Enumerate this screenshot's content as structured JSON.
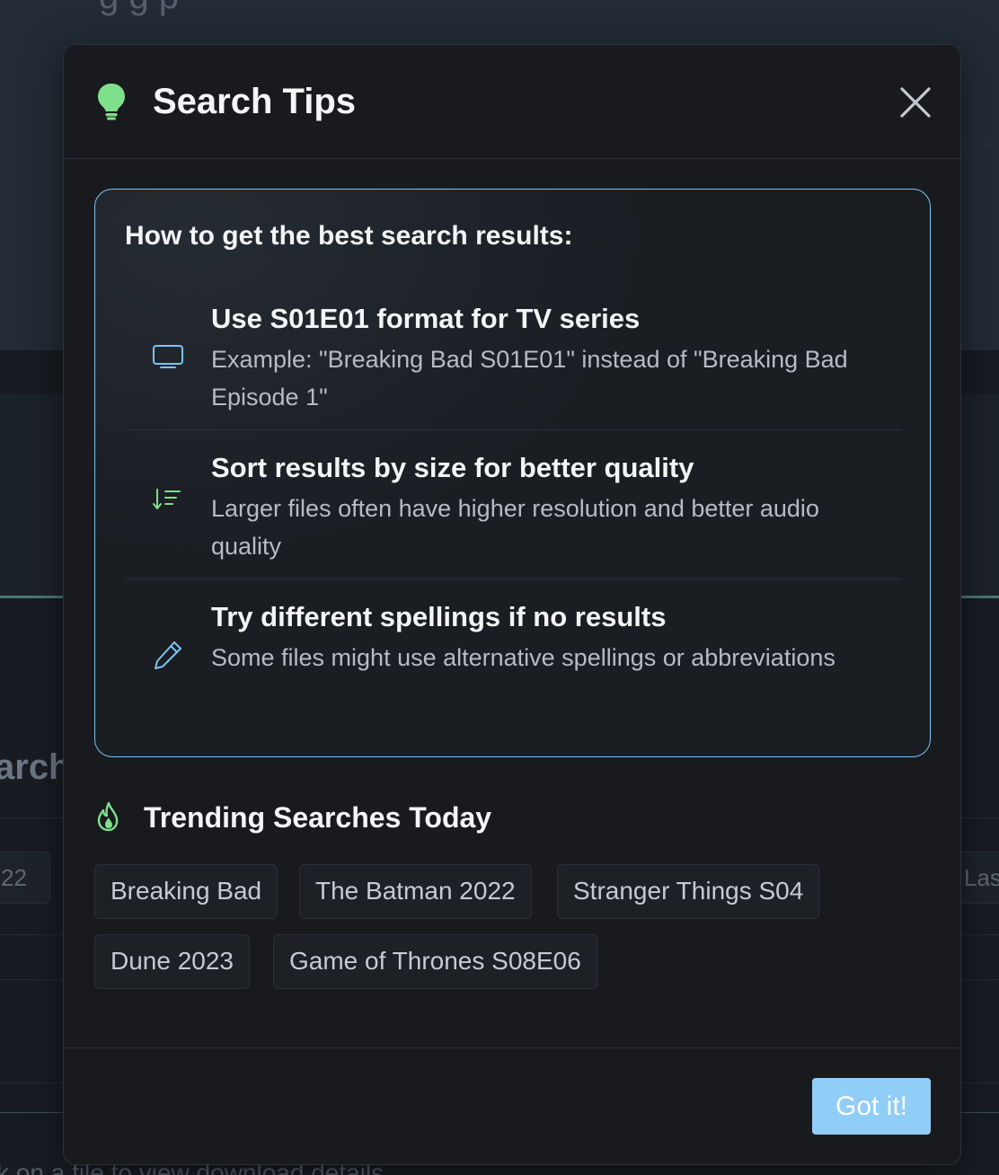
{
  "background": {
    "top_text": "g  g p",
    "partial_heading": "arch",
    "chip_left": "22",
    "chip_right": "Las",
    "bottom_text": "k on a file to view download details"
  },
  "modal": {
    "title": "Search Tips",
    "icons": {
      "header": "lightbulb-icon",
      "close": "close-icon"
    },
    "tips_heading": "How to get the best search results:",
    "tips": [
      {
        "icon": "tv-icon",
        "title": "Use S01E01 format for TV series",
        "desc": "Example: \"Breaking Bad S01E01\" instead of \"Breaking Bad Episode 1\""
      },
      {
        "icon": "sort-descending-icon",
        "title": "Sort results by size for better quality",
        "desc": "Larger files often have higher resolution and better audio quality"
      },
      {
        "icon": "pencil-icon",
        "title": "Try different spellings if no results",
        "desc": "Some files might use alternative spellings or abbreviations"
      }
    ],
    "trending": {
      "icon": "fire-icon",
      "title": "Trending Searches Today",
      "chips": [
        "Breaking Bad",
        "The Batman 2022",
        "Stranger Things S04",
        "Dune 2023",
        "Game of Thrones S08E06"
      ]
    },
    "footer": {
      "button_label": "Got it!"
    }
  },
  "colors": {
    "accent_blue": "#7cc4f5",
    "accent_green": "#7ee08a",
    "button_bg": "#90cdf7",
    "modal_bg": "#181a1e"
  }
}
